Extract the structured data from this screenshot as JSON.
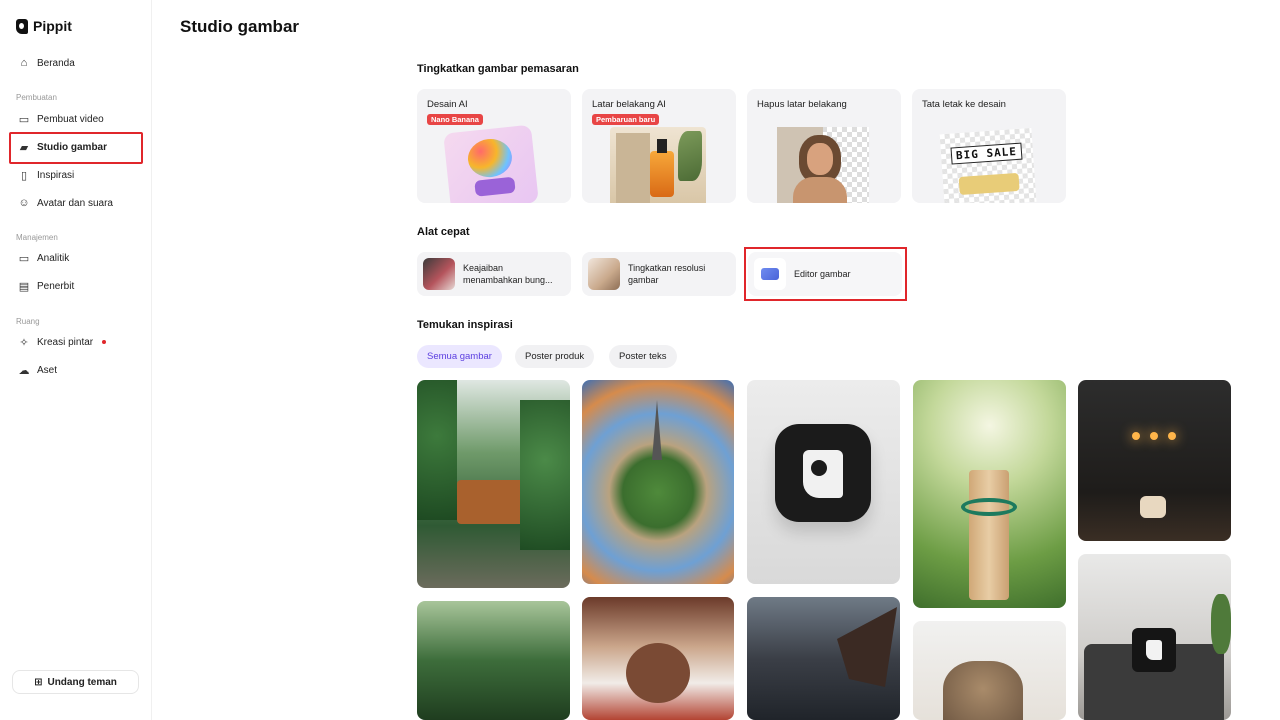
{
  "brand": {
    "name": "Pippit"
  },
  "sidebar": {
    "home": "Beranda",
    "section_create": "Pembuatan",
    "video_maker": "Pembuat video",
    "image_studio": "Studio gambar",
    "inspiration": "Inspirasi",
    "avatar_voice": "Avatar dan suara",
    "section_manage": "Manajemen",
    "analytics": "Analitik",
    "publisher": "Penerbit",
    "section_space": "Ruang",
    "smart_creation": "Kreasi pintar",
    "assets": "Aset",
    "invite": "Undang teman"
  },
  "page": {
    "title": "Studio gambar"
  },
  "marketing": {
    "heading": "Tingkatkan gambar pemasaran",
    "cards": [
      {
        "title": "Desain AI",
        "badge": "Nano Banana"
      },
      {
        "title": "Latar belakang AI",
        "badge": "Pembaruan baru"
      },
      {
        "title": "Hapus latar belakang"
      },
      {
        "title": "Tata letak ke desain",
        "overlay": "BIG SALE"
      }
    ]
  },
  "quick_tools": {
    "heading": "Alat cepat",
    "items": [
      {
        "label_line1": "Keajaiban",
        "label_line2": "menambahkan bung..."
      },
      {
        "label_line1": "Tingkatkan resolusi",
        "label_line2": "gambar"
      },
      {
        "label_line1": "Editor gambar",
        "label_line2": ""
      }
    ]
  },
  "inspiration": {
    "heading": "Temukan inspirasi",
    "filters": [
      "Semua gambar",
      "Poster produk",
      "Poster teks"
    ]
  },
  "colors": {
    "accent": "#5b3ee0",
    "highlight": "#e0262b",
    "badge": "#e84545"
  }
}
